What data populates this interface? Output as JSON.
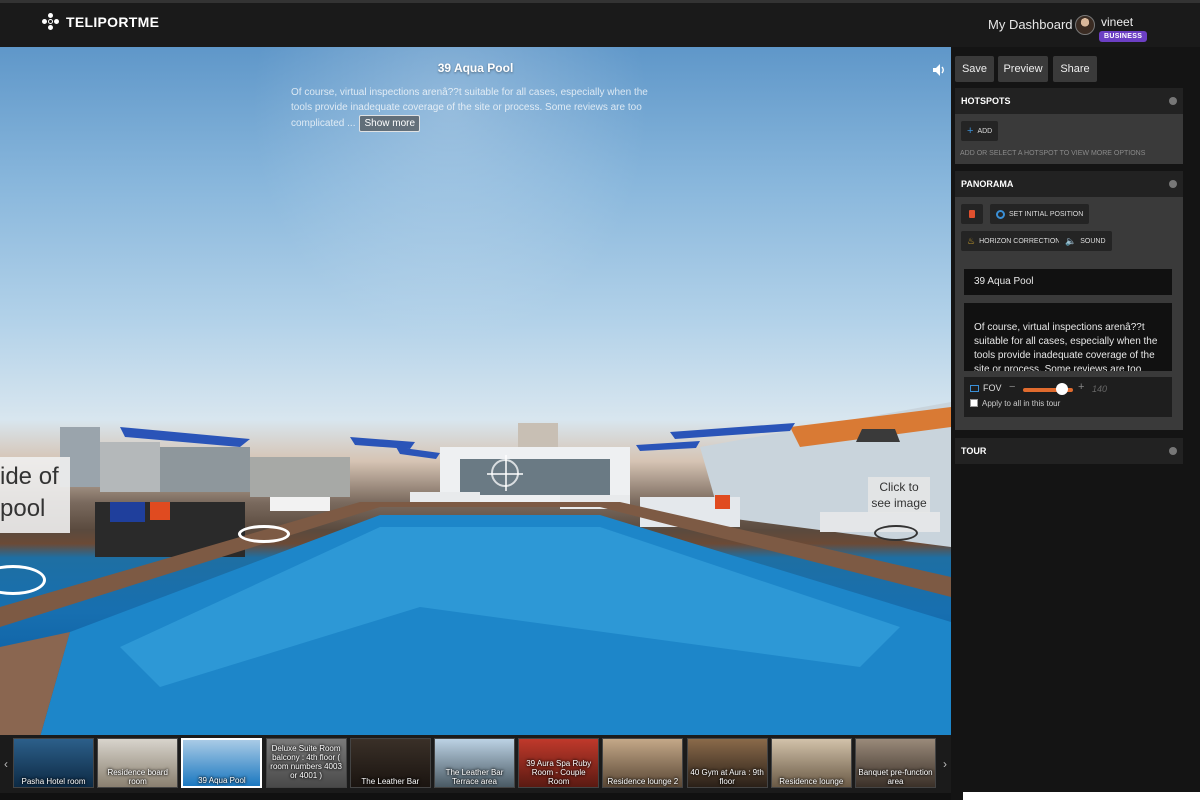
{
  "brand": {
    "name": "TELIPORTME"
  },
  "header": {
    "dashboard_link": "My Dashboard",
    "user_name": "vineet",
    "user_badge": "BUSINESS"
  },
  "viewer": {
    "title": "39 Aqua Pool",
    "description": "Of course, virtual inspections arenâ??t suitable for all cases, especially when the tools provide inadequate coverage of the site or process. Some reviews are too complicated ...",
    "show_more": "Show more",
    "left_label_line1": "ide of",
    "left_label_line2": "pool",
    "click_label_line1": "Click to",
    "click_label_line2": "see image"
  },
  "thumbnails": {
    "prev_arrow": "‹",
    "next_arrow": "›",
    "items": [
      {
        "label": "Pasha Hotel room",
        "color1": "#2c5f8a",
        "color2": "#0d2a44"
      },
      {
        "label": "Residence board room",
        "color1": "#d8d4cc",
        "color2": "#8a8070"
      },
      {
        "label": "39 Aqua Pool",
        "color1": "#a9cbe6",
        "color2": "#1b78c0"
      },
      {
        "label": "Deluxe Suite Room balcony : 4th floor ( room numbers 4003 or 4001 )",
        "color1": "#7a7a7a",
        "color2": "#4a4a4a"
      },
      {
        "label": "The Leather Bar",
        "color1": "#3a3028",
        "color2": "#1a1410"
      },
      {
        "label": "The Leather Bar Terrace area",
        "color1": "#bcd2e4",
        "color2": "#4a5a64"
      },
      {
        "label": "39 Aura Spa Ruby Room - Couple Room",
        "color1": "#c0392b",
        "color2": "#5a1a12"
      },
      {
        "label": "Residence lounge 2",
        "color1": "#c4a888",
        "color2": "#5a4836"
      },
      {
        "label": "40 Gym at Aura : 9th floor",
        "color1": "#8a6a4a",
        "color2": "#2a2018"
      },
      {
        "label": "Residence lounge",
        "color1": "#d2c2aa",
        "color2": "#6a5a46"
      },
      {
        "label": "Banquet pre-function area",
        "color1": "#9a8a7a",
        "color2": "#3a3028"
      }
    ]
  },
  "panel": {
    "save": "Save",
    "preview": "Preview",
    "share": "Share",
    "hotspots": {
      "title": "HOTSPOTS",
      "add_label": "ADD",
      "hint": "ADD OR SELECT A HOTSPOT TO VIEW MORE OPTIONS"
    },
    "panorama": {
      "title": "PANORAMA",
      "set_initial_position": "SET INITIAL POSITION",
      "horizon_correction": "HORIZON CORRECTION",
      "sound": "SOUND",
      "name_value": "39 Aqua Pool",
      "description_value": "Of course, virtual inspections arenâ??t suitable for all cases, especially when the tools provide inadequate coverage of the site or process. Some reviews are too complicated for virtual. It",
      "fov_label": "FOV",
      "fov_minus": "−",
      "fov_plus": "+",
      "fov_value": "140",
      "fov_level_fraction": 0.78,
      "apply_all_label": "Apply to all in this tour"
    },
    "tour": {
      "title": "TOUR"
    }
  },
  "colors": {
    "accent_orange": "#e06b2e",
    "badge_purple": "#6c3fc4",
    "delete_red": "#e0502e",
    "target_blue": "#3a8fd6",
    "horizon_yellow": "#e0b02e"
  }
}
